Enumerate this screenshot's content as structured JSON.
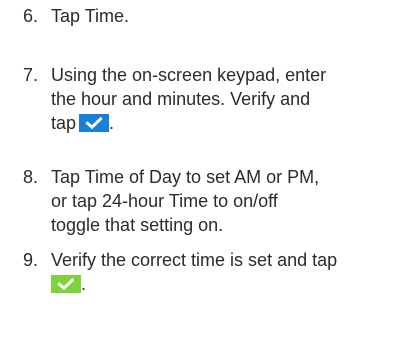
{
  "steps": [
    {
      "number": "6.",
      "lines": [
        "Tap Time."
      ]
    },
    {
      "number": "7.",
      "lines": [
        "Using the on-screen keypad, enter",
        "the hour and minutes. Verify and",
        "tap"
      ],
      "trailing": "."
    },
    {
      "number": "8.",
      "lines": [
        "Tap Time of Day to set AM or PM,",
        "or tap 24-hour Time to on/off",
        "toggle that setting on."
      ]
    },
    {
      "number": "9.",
      "lines": [
        "Verify the correct time is set and tap"
      ],
      "trailing": "."
    }
  ],
  "icons": {
    "confirm_button": "check-icon",
    "step7_button_color": "#1a7fd6",
    "step9_button_color": "#7fd23a"
  }
}
